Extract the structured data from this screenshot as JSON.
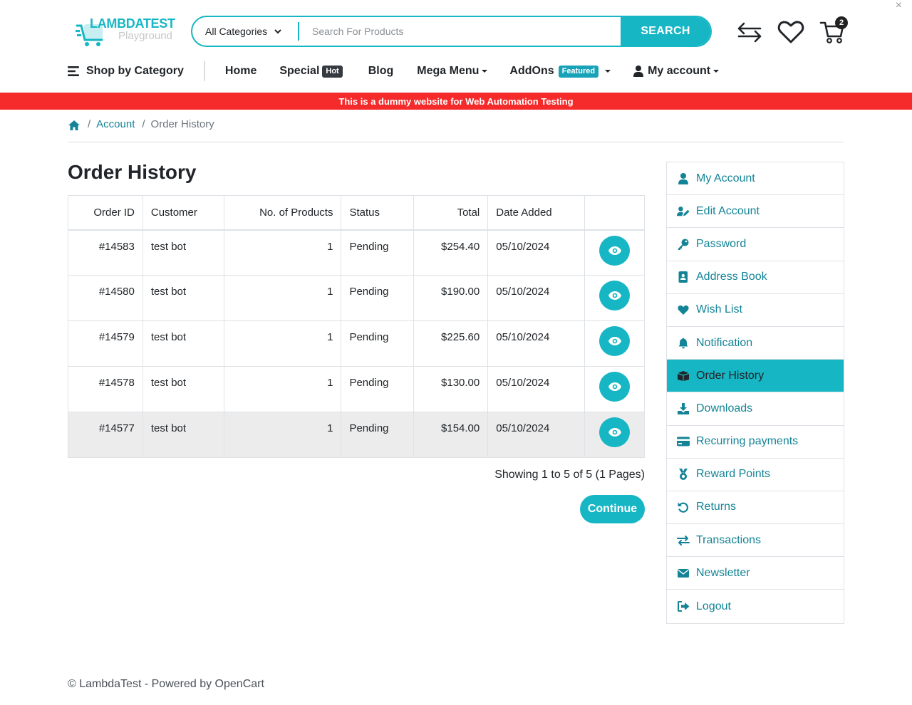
{
  "header": {
    "logo_main": "LAMBDATEST",
    "logo_sub": "Playground",
    "search_category": "All Categories",
    "search_placeholder": "Search For Products",
    "search_button": "SEARCH",
    "cart_count": "2",
    "close_glyph": "×"
  },
  "nav": {
    "shop_by_category": "Shop by Category",
    "home": "Home",
    "special": "Special",
    "special_badge": "Hot",
    "blog": "Blog",
    "mega_menu": "Mega Menu",
    "addons": "AddOns",
    "addons_badge": "Featured",
    "my_account": "My account"
  },
  "banner": "This is a dummy website for Web Automation Testing",
  "breadcrumb": {
    "account": "Account",
    "current": "Order History",
    "sep": "/"
  },
  "page_title": "Order History",
  "table": {
    "headers": [
      "Order ID",
      "Customer",
      "No. of Products",
      "Status",
      "Total",
      "Date Added",
      ""
    ],
    "rows": [
      {
        "id": "#14583",
        "customer": "test bot",
        "products": "1",
        "status": "Pending",
        "total": "$254.40",
        "date": "05/10/2024"
      },
      {
        "id": "#14580",
        "customer": "test bot",
        "products": "1",
        "status": "Pending",
        "total": "$190.00",
        "date": "05/10/2024"
      },
      {
        "id": "#14579",
        "customer": "test bot",
        "products": "1",
        "status": "Pending",
        "total": "$225.60",
        "date": "05/10/2024"
      },
      {
        "id": "#14578",
        "customer": "test bot",
        "products": "1",
        "status": "Pending",
        "total": "$130.00",
        "date": "05/10/2024"
      },
      {
        "id": "#14577",
        "customer": "test bot",
        "products": "1",
        "status": "Pending",
        "total": "$154.00",
        "date": "05/10/2024"
      }
    ]
  },
  "pagination_text": "Showing 1 to 5 of 5 (1 Pages)",
  "continue_label": "Continue",
  "sidebar": {
    "items": [
      {
        "label": "My Account",
        "icon": "user-icon"
      },
      {
        "label": "Edit Account",
        "icon": "user-edit-icon"
      },
      {
        "label": "Password",
        "icon": "key-icon"
      },
      {
        "label": "Address Book",
        "icon": "address-book-icon"
      },
      {
        "label": "Wish List",
        "icon": "heart-icon"
      },
      {
        "label": "Notification",
        "icon": "bell-icon"
      },
      {
        "label": "Order History",
        "icon": "box-icon",
        "active": true
      },
      {
        "label": "Downloads",
        "icon": "download-icon"
      },
      {
        "label": "Recurring payments",
        "icon": "credit-card-icon"
      },
      {
        "label": "Reward Points",
        "icon": "medal-icon"
      },
      {
        "label": "Returns",
        "icon": "undo-icon"
      },
      {
        "label": "Transactions",
        "icon": "exchange-icon"
      },
      {
        "label": "Newsletter",
        "icon": "envelope-icon"
      },
      {
        "label": "Logout",
        "icon": "sign-out-icon"
      }
    ]
  },
  "footer": "© LambdaTest - Powered by OpenCart",
  "colors": {
    "accent": "#16b6c4",
    "link": "#138496",
    "banner": "#f42a2b"
  }
}
